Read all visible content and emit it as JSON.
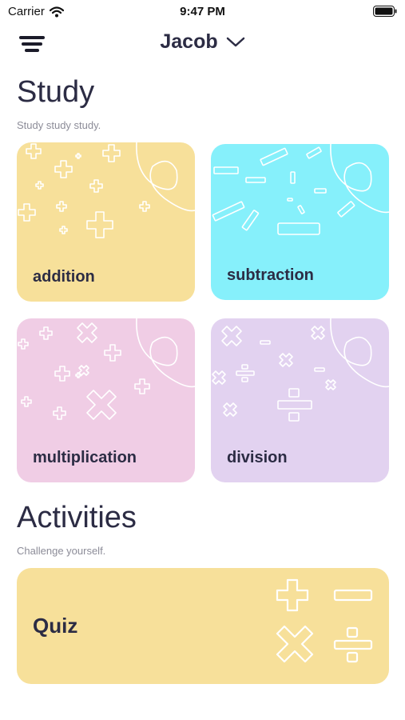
{
  "status_bar": {
    "carrier": "Carrier",
    "time": "9:47 PM"
  },
  "nav": {
    "user_name": "Jacob",
    "menu_icon": "hamburger-menu-icon",
    "dropdown_icon": "chevron-down-icon"
  },
  "study": {
    "title": "Study",
    "subtitle": "Study study study.",
    "cards": [
      {
        "label": "addition",
        "color": "#f7e09a"
      },
      {
        "label": "subtraction",
        "color": "#86f0fb"
      },
      {
        "label": "multiplication",
        "color": "#f0cde5"
      },
      {
        "label": "division",
        "color": "#e2d2f0"
      }
    ]
  },
  "activities": {
    "title": "Activities",
    "subtitle": "Challenge yourself.",
    "cards": [
      {
        "label": "Quiz",
        "color": "#f7e09a"
      }
    ]
  }
}
